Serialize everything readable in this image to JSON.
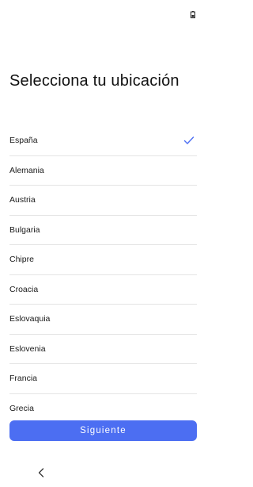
{
  "status_bar": {
    "icons": [
      "battery-icon"
    ]
  },
  "title": "Selecciona tu ubicación",
  "countries": [
    {
      "label": "España",
      "selected": true
    },
    {
      "label": "Alemania",
      "selected": false
    },
    {
      "label": "Austria",
      "selected": false
    },
    {
      "label": "Bulgaria",
      "selected": false
    },
    {
      "label": "Chipre",
      "selected": false
    },
    {
      "label": "Croacia",
      "selected": false
    },
    {
      "label": "Eslovaquia",
      "selected": false
    },
    {
      "label": "Eslovenia",
      "selected": false
    },
    {
      "label": "Francia",
      "selected": false
    },
    {
      "label": "Grecia",
      "selected": false
    }
  ],
  "selected_icon": "check-icon",
  "next_button_label": "Siguiente",
  "nav": {
    "back_icon": "chevron-left-icon"
  },
  "colors": {
    "accent": "#4c6ef2",
    "check": "#4c6ef2",
    "divider": "#e4e4e4",
    "background": "#ffffff"
  }
}
